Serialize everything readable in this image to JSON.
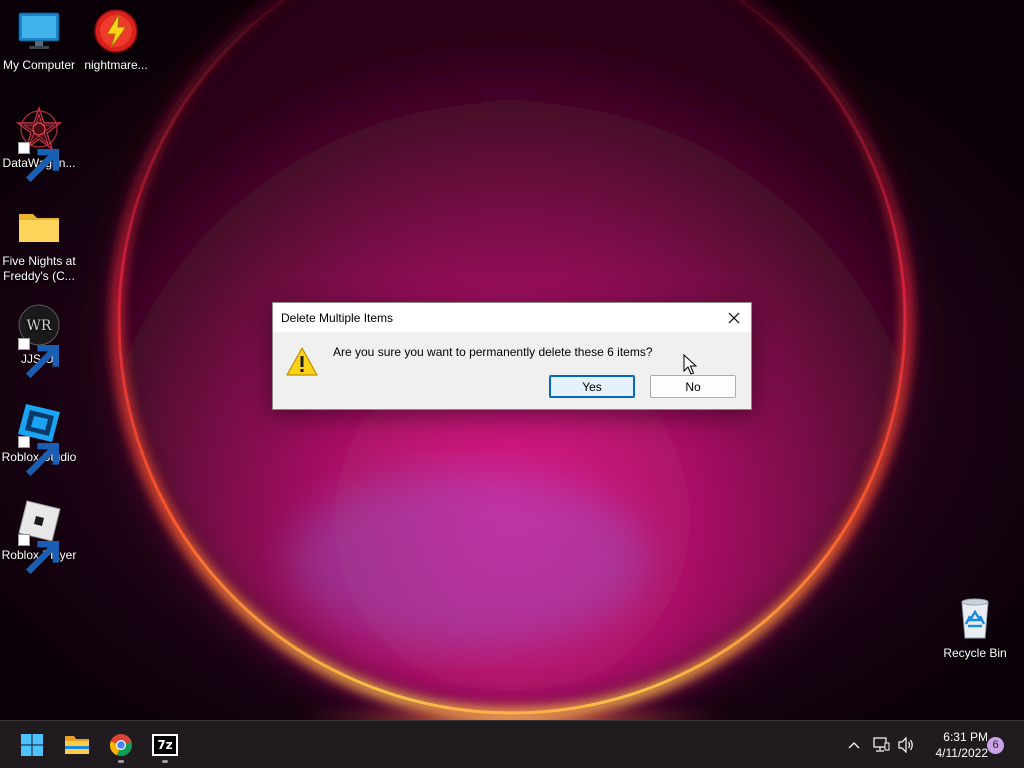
{
  "desktop": {
    "icons": [
      {
        "label": "My Computer",
        "icon": "monitor-icon"
      },
      {
        "label": "nightmare...",
        "icon": "lightning-app-icon"
      },
      {
        "label": "DataWagon...",
        "icon": "pentagram-app-icon"
      },
      {
        "label": "Five Nights at Freddy's (C...",
        "icon": "folder-icon"
      },
      {
        "label": "JJS-UI",
        "icon": "jjs-app-icon"
      },
      {
        "label": "Roblox Studio",
        "icon": "roblox-studio-icon"
      },
      {
        "label": "Roblox Player",
        "icon": "roblox-player-icon"
      },
      {
        "label": "Recycle Bin",
        "icon": "recycle-bin-icon"
      }
    ]
  },
  "dialog": {
    "title": "Delete Multiple Items",
    "message": "Are you sure you want to permanently delete these 6 items?",
    "yes_label": "Yes",
    "no_label": "No",
    "icon": "warning-icon"
  },
  "taskbar": {
    "apps": [
      {
        "name": "Start",
        "icon": "windows-start-icon"
      },
      {
        "name": "File Explorer",
        "icon": "file-explorer-icon"
      },
      {
        "name": "Google Chrome",
        "icon": "chrome-icon"
      },
      {
        "name": "7-Zip",
        "icon": "7zip-icon",
        "label": "7z"
      }
    ],
    "tray": {
      "icons": [
        "chevron-up-icon",
        "network-icon",
        "volume-icon"
      ],
      "time": "6:31 PM",
      "date": "4/11/2022",
      "notification_count": "6"
    }
  },
  "colors": {
    "accent": "#0067c0",
    "taskbar_bg": "#1f1b1f",
    "dialog_bg": "#f0f0f0"
  }
}
